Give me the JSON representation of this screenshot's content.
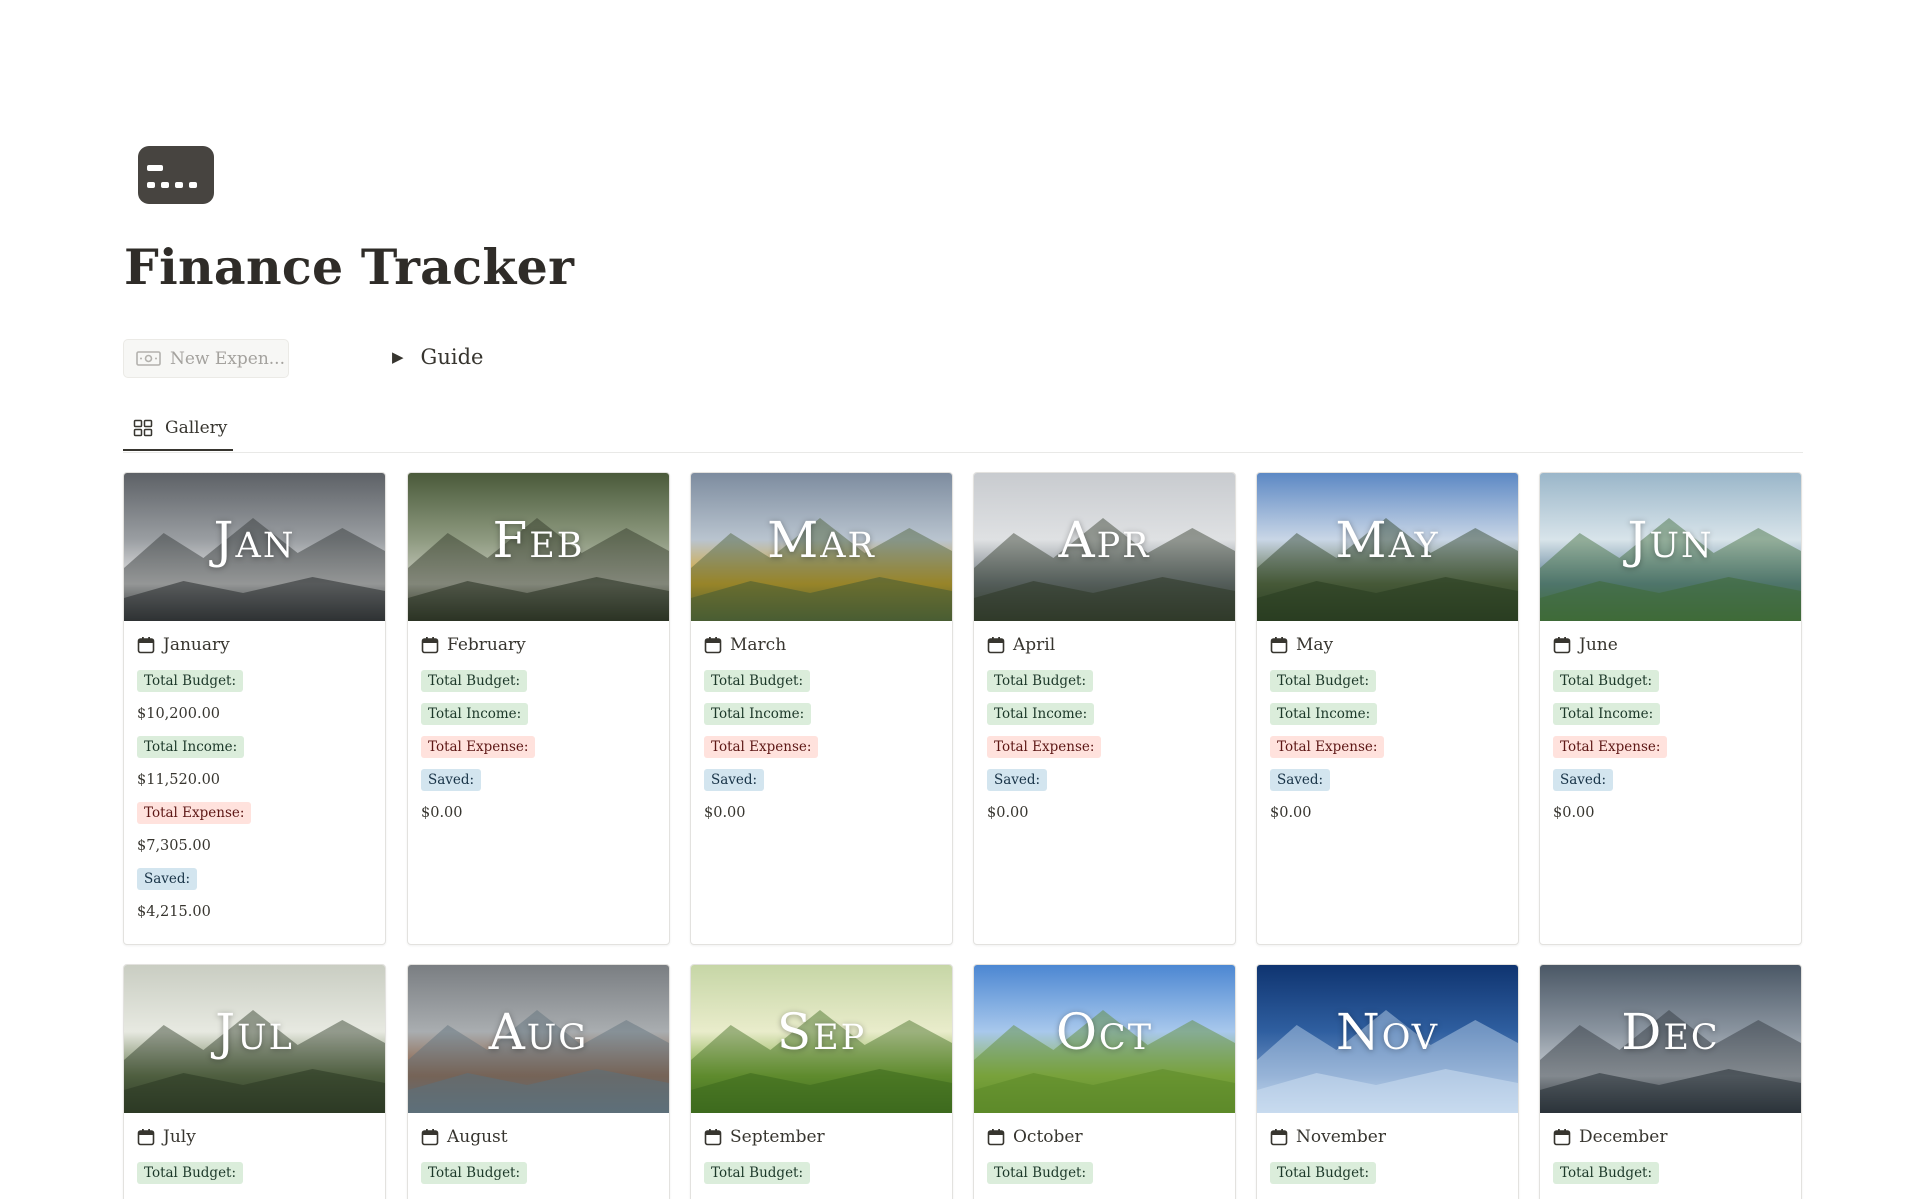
{
  "page": {
    "title": "Finance Tracker",
    "icon": "credit-card-icon"
  },
  "actions": {
    "new_button_label": "New Expen...",
    "new_button_icon": "money-icon",
    "guide_label": "Guide"
  },
  "view": {
    "tab_label": "Gallery",
    "tab_icon": "gallery-grid-icon"
  },
  "colors": {
    "budget_tag": "#dbeddb",
    "income_tag": "#dbeddb",
    "expense_tag": "#ffe2dd",
    "saved_tag": "#d3e5ef"
  },
  "cards": [
    {
      "cover": "Jan",
      "name": "January",
      "props": [
        {
          "kind": "tag",
          "color": "green",
          "text": "Total Budget:"
        },
        {
          "kind": "value",
          "text": "$10,200.00"
        },
        {
          "kind": "tag",
          "color": "green",
          "text": "Total Income:"
        },
        {
          "kind": "value",
          "text": "$11,520.00"
        },
        {
          "kind": "tag",
          "color": "red",
          "text": "Total Expense:"
        },
        {
          "kind": "value",
          "text": "$7,305.00"
        },
        {
          "kind": "tag",
          "color": "blue",
          "text": "Saved:"
        },
        {
          "kind": "value",
          "text": "$4,215.00"
        }
      ]
    },
    {
      "cover": "Feb",
      "name": "February",
      "props": [
        {
          "kind": "tag",
          "color": "green",
          "text": "Total Budget:"
        },
        {
          "kind": "tag",
          "color": "green",
          "text": "Total Income:"
        },
        {
          "kind": "tag",
          "color": "red",
          "text": "Total Expense:"
        },
        {
          "kind": "tag",
          "color": "blue",
          "text": "Saved:"
        },
        {
          "kind": "value",
          "text": "$0.00"
        }
      ]
    },
    {
      "cover": "Mar",
      "name": "March",
      "props": [
        {
          "kind": "tag",
          "color": "green",
          "text": "Total Budget:"
        },
        {
          "kind": "tag",
          "color": "green",
          "text": "Total Income:"
        },
        {
          "kind": "tag",
          "color": "red",
          "text": "Total Expense:"
        },
        {
          "kind": "tag",
          "color": "blue",
          "text": "Saved:"
        },
        {
          "kind": "value",
          "text": "$0.00"
        }
      ]
    },
    {
      "cover": "Apr",
      "name": "April",
      "props": [
        {
          "kind": "tag",
          "color": "green",
          "text": "Total Budget:"
        },
        {
          "kind": "tag",
          "color": "green",
          "text": "Total Income:"
        },
        {
          "kind": "tag",
          "color": "red",
          "text": "Total Expense:"
        },
        {
          "kind": "tag",
          "color": "blue",
          "text": "Saved:"
        },
        {
          "kind": "value",
          "text": "$0.00"
        }
      ]
    },
    {
      "cover": "May",
      "name": "May",
      "props": [
        {
          "kind": "tag",
          "color": "green",
          "text": "Total Budget:"
        },
        {
          "kind": "tag",
          "color": "green",
          "text": "Total Income:"
        },
        {
          "kind": "tag",
          "color": "red",
          "text": "Total Expense:"
        },
        {
          "kind": "tag",
          "color": "blue",
          "text": "Saved:"
        },
        {
          "kind": "value",
          "text": "$0.00"
        }
      ]
    },
    {
      "cover": "Jun",
      "name": "June",
      "props": [
        {
          "kind": "tag",
          "color": "green",
          "text": "Total Budget:"
        },
        {
          "kind": "tag",
          "color": "green",
          "text": "Total Income:"
        },
        {
          "kind": "tag",
          "color": "red",
          "text": "Total Expense:"
        },
        {
          "kind": "tag",
          "color": "blue",
          "text": "Saved:"
        },
        {
          "kind": "value",
          "text": "$0.00"
        }
      ]
    },
    {
      "cover": "Jul",
      "name": "July",
      "props": [
        {
          "kind": "tag",
          "color": "green",
          "text": "Total Budget:"
        }
      ]
    },
    {
      "cover": "Aug",
      "name": "August",
      "props": [
        {
          "kind": "tag",
          "color": "green",
          "text": "Total Budget:"
        }
      ]
    },
    {
      "cover": "Sep",
      "name": "September",
      "props": [
        {
          "kind": "tag",
          "color": "green",
          "text": "Total Budget:"
        }
      ]
    },
    {
      "cover": "Oct",
      "name": "October",
      "props": [
        {
          "kind": "tag",
          "color": "green",
          "text": "Total Budget:"
        }
      ]
    },
    {
      "cover": "Nov",
      "name": "November",
      "props": [
        {
          "kind": "tag",
          "color": "green",
          "text": "Total Budget:"
        }
      ]
    },
    {
      "cover": "Dec",
      "name": "December",
      "props": [
        {
          "kind": "tag",
          "color": "green",
          "text": "Total Budget:"
        }
      ]
    }
  ]
}
